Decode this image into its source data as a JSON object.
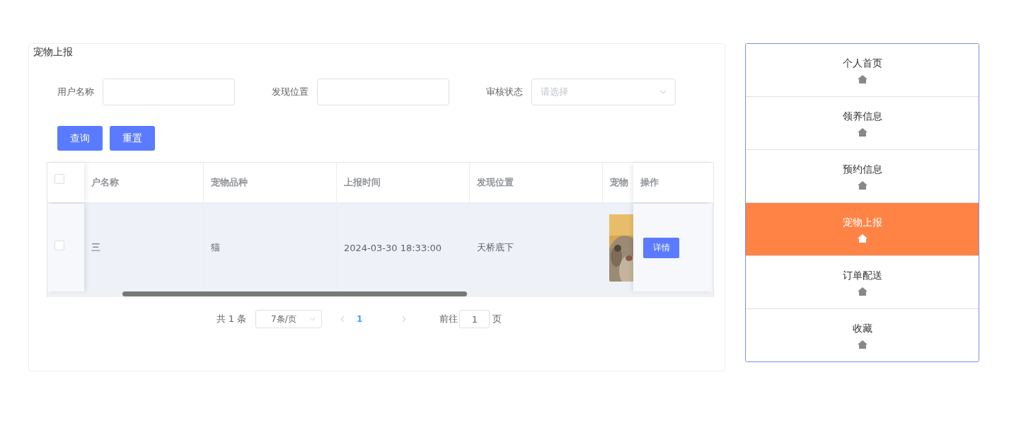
{
  "card": {
    "title": "宠物上报"
  },
  "filters": [
    {
      "kind": "text",
      "label": "用户名称"
    },
    {
      "kind": "text",
      "label": "发现位置"
    },
    {
      "kind": "select",
      "label": "审核状态",
      "placeholder": "请选择"
    }
  ],
  "buttons": [
    "查询",
    "重置"
  ],
  "table": {
    "header_checked": false,
    "columns": [
      "户名称",
      "宠物品种",
      "上报时间",
      "发现位置",
      "宠物",
      "操作"
    ],
    "rows": [
      {
        "checked": false,
        "cells": [
          "三",
          "猫",
          "2024-03-30 18:33:00",
          "天桥底下"
        ],
        "action": "详情"
      }
    ]
  },
  "pagination": {
    "total": "共 1 条",
    "page_size": "7条/页",
    "pages": [
      {
        "label": "1",
        "selected": true
      }
    ],
    "goto_label": "前往",
    "goto_value": "1",
    "goto_suffix": "页"
  },
  "nav": {
    "items": [
      {
        "label": "个人首页",
        "selected": false
      },
      {
        "label": "领养信息",
        "selected": false
      },
      {
        "label": "预约信息",
        "selected": false
      },
      {
        "label": "宠物上报",
        "selected": true
      },
      {
        "label": "订单配送",
        "selected": false
      },
      {
        "label": "收藏",
        "selected": false
      }
    ]
  }
}
